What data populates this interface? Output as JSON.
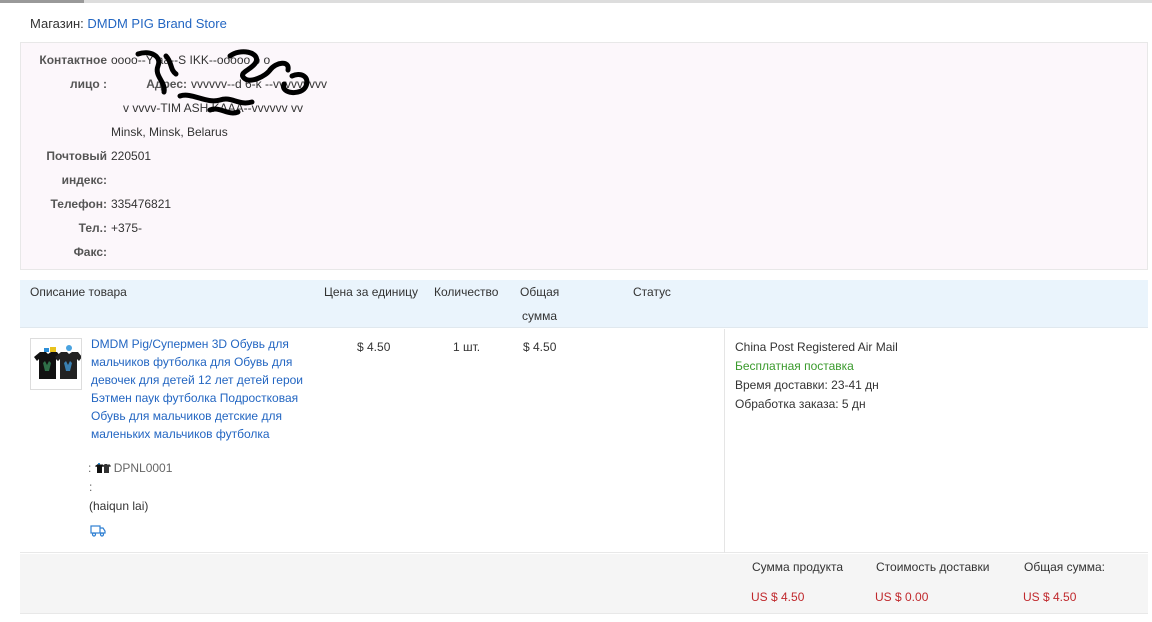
{
  "store": {
    "label": "Магазин:",
    "name": "DMDM PIG Brand Store"
  },
  "address": {
    "contact_label_1": "Контактное",
    "contact_label_2": "лицо :",
    "contact_value": "oooo--Y      aa--S     IKK--ooooo o o",
    "address_label": "Адрес:",
    "address_line_1": "vvvvvv--d 6-k    --vvvvvvvvv",
    "address_line_2": "v vvvv-TIM    ASH    KAAA--vvvvvv vv",
    "address_line_3": "Minsk, Minsk, Belarus",
    "postal_label_1": "Почтовый",
    "postal_label_2": "индекс:",
    "postal_value": "220501",
    "phone_label": "Телефон:",
    "phone_value": "335476821",
    "tel_label": "Тел.:",
    "tel_value": "+375-",
    "fax_label": "Факс:",
    "fax_value": ""
  },
  "table": {
    "col_description": "Описание товара",
    "col_unit_price": "Цена за единицу",
    "col_quantity": "Количество",
    "col_total_1": "Общая",
    "col_total_2": "сумма",
    "col_status": "Статус"
  },
  "item": {
    "title": "DMDM Pig/Супермен 3D Обувь для мальчиков футболка для Обувь для девочек для детей 12 лет детей герои Бэтмен паук футболка Подростковая Обувь для мальчиков детские для маленьких мальчиков футболка",
    "sku_prefix": ":",
    "sku_code": "DPNL0001",
    "sku_colon": ":",
    "seller": "(haiqun lai)",
    "unit_price": "$ 4.50",
    "quantity": "1 шт.",
    "total": "$ 4.50",
    "shipping_method": "China Post Registered Air Mail",
    "shipping_cost": "Бесплатная поставка",
    "delivery_time": "Время доставки:  23-41 дн",
    "processing_time": "Обработка заказа:  5 дн"
  },
  "summary": {
    "product_sum_label": "Сумма продукта",
    "product_sum_value": "US $ 4.50",
    "shipping_label": "Стоимость доставки",
    "shipping_value": "US $ 0.00",
    "total_label": "Общая сумма:",
    "total_value": "US $ 4.50"
  },
  "colors": {
    "link": "#2366c2",
    "free_shipping": "#3a9a2c",
    "price_red": "#c0282c",
    "header_bg": "#eaf4fc",
    "address_bg": "#fcf7fb"
  },
  "icons": {
    "sku": "tshirt-thumbnail-icon",
    "logistics": "truck-icon"
  }
}
